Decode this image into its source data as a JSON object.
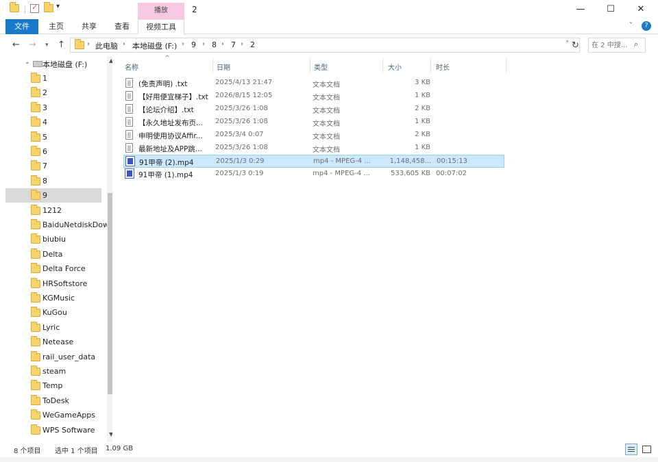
{
  "window": {
    "title": "2",
    "contextual_tab_group": "播放",
    "minimize": "—",
    "maximize": "☐",
    "close": "✕"
  },
  "quick_access": {
    "dropdown": "▾"
  },
  "ribbon": {
    "tabs": [
      "文件",
      "主页",
      "共享",
      "查看",
      "视频工具"
    ],
    "collapse": "˅",
    "help": "?"
  },
  "navigation": {
    "back": "←",
    "forward": "→",
    "recent": "▾",
    "up": "↑",
    "refresh": "↻",
    "address_dropdown": "˅"
  },
  "breadcrumb": [
    "此电脑",
    "本地磁盘 (F:)",
    "9",
    "8",
    "7",
    "2"
  ],
  "breadcrumb_sep": "›",
  "search": {
    "placeholder": "在 2 中搜...",
    "icon": "⌕"
  },
  "nav_pane": {
    "drive_chevron": "⌄",
    "drive": "本地磁盘 (F:)",
    "folders": [
      "1",
      "2",
      "3",
      "4",
      "5",
      "6",
      "7",
      "8",
      "9",
      "1212",
      "BaiduNetdiskDow",
      "biubiu",
      "Delta",
      "Delta Force",
      "HRSoftstore",
      "KGMusic",
      "KuGou",
      "Lyric",
      "Netease",
      "rail_user_data",
      "steam",
      "Temp",
      "ToDesk",
      "WeGameApps",
      "WPS Software"
    ],
    "selected_index": 8,
    "scroll_up": "▲",
    "scroll_down": "▼"
  },
  "file_list": {
    "sort_arrow": "^",
    "columns": [
      "名称",
      "日期",
      "类型",
      "大小",
      "时长"
    ],
    "rows": [
      {
        "name": "(免责声明) .txt",
        "date": "2025/4/13 21:47",
        "type": "文本文档",
        "size": "3 KB",
        "duration": "",
        "icon": "txt-icon"
      },
      {
        "name": "【好用便宜梯子】.txt",
        "date": "2026/8/15 12:05",
        "type": "文本文档",
        "size": "1 KB",
        "duration": "",
        "icon": "txt-icon"
      },
      {
        "name": "【论坛介绍】.txt",
        "date": "2025/3/26 1:08",
        "type": "文本文档",
        "size": "2 KB",
        "duration": "",
        "icon": "txt-icon"
      },
      {
        "name": "【永久地址发布页...",
        "date": "2025/3/26 1:08",
        "type": "文本文档",
        "size": "1 KB",
        "duration": "",
        "icon": "txt-icon"
      },
      {
        "name": "申明使用协议Affir...",
        "date": "2025/3/4 0:07",
        "type": "文本文档",
        "size": "2 KB",
        "duration": "",
        "icon": "txt-icon"
      },
      {
        "name": "最新地址及APP跳...",
        "date": "2025/3/26 1:08",
        "type": "文本文档",
        "size": "1 KB",
        "duration": "",
        "icon": "txt-icon"
      },
      {
        "name": "91甲帝 (2).mp4",
        "date": "2025/1/3 0:29",
        "type": "mp4 - MPEG-4 ...",
        "size": "1,148,458...",
        "duration": "00:15:13",
        "icon": "mp4-icon"
      },
      {
        "name": "91甲帝 (1).mp4",
        "date": "2025/1/3 0:19",
        "type": "mp4 - MPEG-4 ...",
        "size": "533,605 KB",
        "duration": "00:07:02",
        "icon": "mp4-icon"
      }
    ],
    "selected_index": 6
  },
  "status": {
    "item_count": "8 个项目",
    "selected": "选中 1 个项目",
    "size": "1.09 GB"
  }
}
